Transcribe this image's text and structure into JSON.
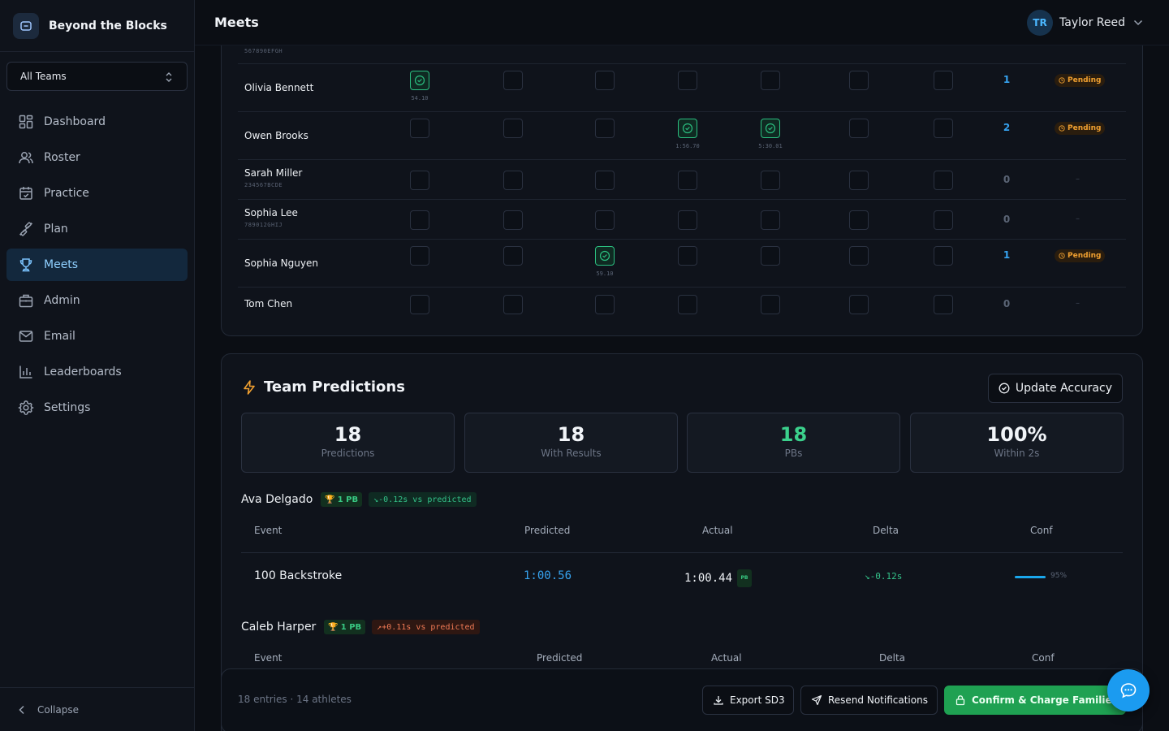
{
  "brand": {
    "name": "Beyond the Blocks"
  },
  "team_select": {
    "value": "All Teams"
  },
  "nav": [
    {
      "label": "Dashboard",
      "icon": "dashboard-icon"
    },
    {
      "label": "Roster",
      "icon": "users-icon"
    },
    {
      "label": "Practice",
      "icon": "calendar-check-icon"
    },
    {
      "label": "Plan",
      "icon": "dumbbell-icon"
    },
    {
      "label": "Meets",
      "icon": "trophy-icon",
      "active": true
    },
    {
      "label": "Admin",
      "icon": "building-icon"
    },
    {
      "label": "Email",
      "icon": "mail-icon"
    },
    {
      "label": "Leaderboards",
      "icon": "bar-chart-icon"
    },
    {
      "label": "Settings",
      "icon": "gear-icon"
    }
  ],
  "collapse_label": "Collapse",
  "header": {
    "title": "Meets"
  },
  "user": {
    "initials": "TR",
    "name": "Taylor Reed"
  },
  "roster": {
    "partial_top_id": "567890EFGH",
    "rows": [
      {
        "name": "Olivia Bennett",
        "sub": "",
        "checked": [
          0
        ],
        "times": {
          "0": "54.10"
        },
        "count": "1",
        "status": "Pending"
      },
      {
        "name": "Owen Brooks",
        "sub": "",
        "checked": [
          3,
          4
        ],
        "times": {
          "3": "1:56.70",
          "4": "5:30.01"
        },
        "count": "2",
        "status": "Pending"
      },
      {
        "name": "Sarah Miller",
        "sub": "234567BCDE",
        "checked": [],
        "times": {},
        "count": "0",
        "status": "–"
      },
      {
        "name": "Sophia Lee",
        "sub": "789012GHIJ",
        "checked": [],
        "times": {},
        "count": "0",
        "status": "–"
      },
      {
        "name": "Sophia Nguyen",
        "sub": "",
        "checked": [
          2
        ],
        "times": {
          "2": "59.10"
        },
        "count": "1",
        "status": "Pending"
      },
      {
        "name": "Tom Chen",
        "sub": "",
        "checked": [],
        "times": {},
        "count": "0",
        "status": "–"
      }
    ]
  },
  "predictions": {
    "title": "Team Predictions",
    "update_button": "Update Accuracy",
    "stats": [
      {
        "value": "18",
        "label": "Predictions"
      },
      {
        "value": "18",
        "label": "With Results"
      },
      {
        "value": "18",
        "label": "PBs",
        "green": true
      },
      {
        "value": "100%",
        "label": "Within 2s"
      }
    ],
    "athletes": [
      {
        "name": "Ava Delgado",
        "pb_badge": "1 PB",
        "vs_text": "-0.12s vs predicted",
        "vs_good": true,
        "headers": [
          "Event",
          "Predicted",
          "Actual",
          "Delta",
          "Conf"
        ],
        "rows": [
          {
            "event": "100 Backstroke",
            "predicted": "1:00.56",
            "actual": "1:00.44",
            "pb": "PB",
            "delta": "-0.12s",
            "conf": "95%"
          }
        ]
      },
      {
        "name": "Caleb Harper",
        "pb_badge": "1 PB",
        "vs_text": "+0.11s vs predicted",
        "vs_good": false,
        "headers": [
          "Event",
          "Predicted",
          "Actual",
          "Delta",
          "Conf"
        ],
        "rows": []
      }
    ]
  },
  "footer": {
    "info": "18 entries · 14 athletes",
    "export_button": "Export SD3",
    "resend_button": "Resend Notifications",
    "confirm_button": "Confirm & Charge Families"
  },
  "colors": {
    "accent": "#1b9bf0",
    "success": "#1fa152",
    "pending": "#f0a030"
  }
}
